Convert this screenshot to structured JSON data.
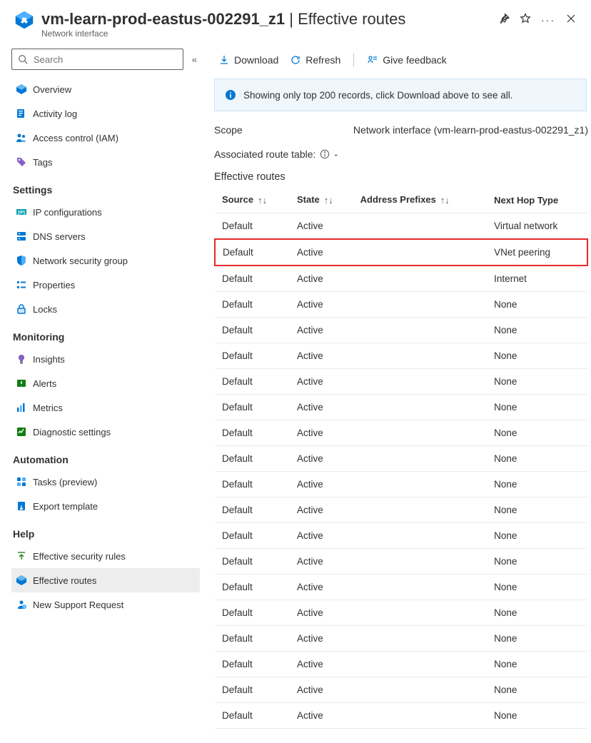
{
  "header": {
    "resource_name": "vm-learn-prod-eastus-002291_z1",
    "title_separator": " | ",
    "page_name": "Effective routes",
    "subtitle": "Network interface"
  },
  "search": {
    "placeholder": "Search"
  },
  "nav": {
    "top": [
      {
        "label": "Overview"
      },
      {
        "label": "Activity log"
      },
      {
        "label": "Access control (IAM)"
      },
      {
        "label": "Tags"
      }
    ],
    "settings_header": "Settings",
    "settings": [
      {
        "label": "IP configurations"
      },
      {
        "label": "DNS servers"
      },
      {
        "label": "Network security group"
      },
      {
        "label": "Properties"
      },
      {
        "label": "Locks"
      }
    ],
    "monitoring_header": "Monitoring",
    "monitoring": [
      {
        "label": "Insights"
      },
      {
        "label": "Alerts"
      },
      {
        "label": "Metrics"
      },
      {
        "label": "Diagnostic settings"
      }
    ],
    "automation_header": "Automation",
    "automation": [
      {
        "label": "Tasks (preview)"
      },
      {
        "label": "Export template"
      }
    ],
    "help_header": "Help",
    "help": [
      {
        "label": "Effective security rules"
      },
      {
        "label": "Effective routes"
      },
      {
        "label": "New Support Request"
      }
    ]
  },
  "commands": {
    "download": "Download",
    "refresh": "Refresh",
    "feedback": "Give feedback"
  },
  "info": "Showing only top 200 records, click Download above to see all.",
  "scope": {
    "label": "Scope",
    "value": "Network interface (vm-learn-prod-eastus-002291_z1)"
  },
  "associated": {
    "label": "Associated route table:",
    "value": "-"
  },
  "table": {
    "title": "Effective routes",
    "headers": {
      "source": "Source",
      "state": "State",
      "prefixes": "Address Prefixes",
      "nexthop": "Next Hop Type"
    },
    "rows": [
      {
        "source": "Default",
        "state": "Active",
        "prefixes": "",
        "nexthop": "Virtual network",
        "highlight": false
      },
      {
        "source": "Default",
        "state": "Active",
        "prefixes": "",
        "nexthop": "VNet peering",
        "highlight": true
      },
      {
        "source": "Default",
        "state": "Active",
        "prefixes": "",
        "nexthop": "Internet",
        "highlight": false
      },
      {
        "source": "Default",
        "state": "Active",
        "prefixes": "",
        "nexthop": "None",
        "highlight": false
      },
      {
        "source": "Default",
        "state": "Active",
        "prefixes": "",
        "nexthop": "None",
        "highlight": false
      },
      {
        "source": "Default",
        "state": "Active",
        "prefixes": "",
        "nexthop": "None",
        "highlight": false
      },
      {
        "source": "Default",
        "state": "Active",
        "prefixes": "",
        "nexthop": "None",
        "highlight": false
      },
      {
        "source": "Default",
        "state": "Active",
        "prefixes": "",
        "nexthop": "None",
        "highlight": false
      },
      {
        "source": "Default",
        "state": "Active",
        "prefixes": "",
        "nexthop": "None",
        "highlight": false
      },
      {
        "source": "Default",
        "state": "Active",
        "prefixes": "",
        "nexthop": "None",
        "highlight": false
      },
      {
        "source": "Default",
        "state": "Active",
        "prefixes": "",
        "nexthop": "None",
        "highlight": false
      },
      {
        "source": "Default",
        "state": "Active",
        "prefixes": "",
        "nexthop": "None",
        "highlight": false
      },
      {
        "source": "Default",
        "state": "Active",
        "prefixes": "",
        "nexthop": "None",
        "highlight": false
      },
      {
        "source": "Default",
        "state": "Active",
        "prefixes": "",
        "nexthop": "None",
        "highlight": false
      },
      {
        "source": "Default",
        "state": "Active",
        "prefixes": "",
        "nexthop": "None",
        "highlight": false
      },
      {
        "source": "Default",
        "state": "Active",
        "prefixes": "",
        "nexthop": "None",
        "highlight": false
      },
      {
        "source": "Default",
        "state": "Active",
        "prefixes": "",
        "nexthop": "None",
        "highlight": false
      },
      {
        "source": "Default",
        "state": "Active",
        "prefixes": "",
        "nexthop": "None",
        "highlight": false
      },
      {
        "source": "Default",
        "state": "Active",
        "prefixes": "",
        "nexthop": "None",
        "highlight": false
      },
      {
        "source": "Default",
        "state": "Active",
        "prefixes": "",
        "nexthop": "None",
        "highlight": false
      }
    ]
  }
}
